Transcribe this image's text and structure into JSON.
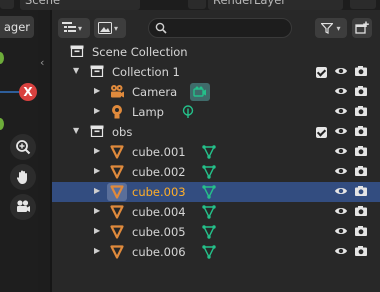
{
  "header": {
    "scene_label": "Scene",
    "render_layer_label": "RenderLayer",
    "search_placeholder": ""
  },
  "left_toolbar": {
    "tab_label": "ager"
  },
  "colors": {
    "selected_row": "#334d80",
    "selected_text": "#ffaf29",
    "object_orange": "#e08a3c",
    "mesh_data_green": "#24c08a",
    "gizmo_red": "#d9413f",
    "gizmo_green": "#6dac3a"
  },
  "outliner": {
    "root": "Scene Collection",
    "items": [
      {
        "name": "Collection 1",
        "kind": "collection",
        "icon": "collection-icon",
        "expanded": true,
        "checked": true
      },
      {
        "name": "Camera",
        "kind": "object",
        "icon": "camera-icon",
        "data_icon": "camera-data-icon"
      },
      {
        "name": "Lamp",
        "kind": "object",
        "icon": "lamp-icon",
        "data_icon": "lamp-data-icon"
      },
      {
        "name": "obs",
        "kind": "collection",
        "icon": "collection-icon",
        "expanded": true,
        "checked": true
      },
      {
        "name": "cube.001",
        "kind": "object",
        "icon": "mesh-icon",
        "data_icon": "mesh-data-icon"
      },
      {
        "name": "cube.002",
        "kind": "object",
        "icon": "mesh-icon",
        "data_icon": "mesh-data-icon"
      },
      {
        "name": "cube.003",
        "kind": "object",
        "icon": "mesh-icon",
        "data_icon": "mesh-data-icon",
        "selected": true
      },
      {
        "name": "cube.004",
        "kind": "object",
        "icon": "mesh-icon",
        "data_icon": "mesh-data-icon"
      },
      {
        "name": "cube.005",
        "kind": "object",
        "icon": "mesh-icon",
        "data_icon": "mesh-data-icon"
      },
      {
        "name": "cube.006",
        "kind": "object",
        "icon": "mesh-icon",
        "data_icon": "mesh-data-icon"
      }
    ]
  }
}
